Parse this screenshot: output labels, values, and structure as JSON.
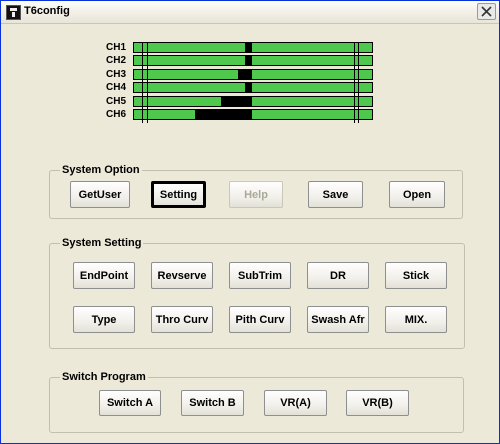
{
  "window": {
    "title": "T6config"
  },
  "channels": [
    {
      "label": "CH1",
      "value": 0.03
    },
    {
      "label": "CH2",
      "value": 0.03
    },
    {
      "label": "CH3",
      "value": 0.06
    },
    {
      "label": "CH4",
      "value": 0.03
    },
    {
      "label": "CH5",
      "value": 0.13
    },
    {
      "label": "CH6",
      "value": 0.24
    }
  ],
  "system_option": {
    "title": "System Option",
    "buttons": [
      "GetUser",
      "Setting",
      "Help",
      "Save",
      "Open"
    ]
  },
  "system_setting": {
    "title": "System Setting",
    "row1": [
      "EndPoint",
      "Revserve",
      "SubTrim",
      "DR",
      "Stick"
    ],
    "row2": [
      "Type",
      "Thro Curv",
      "Pith Curv",
      "Swash Afr",
      "MIX."
    ]
  },
  "switch_program": {
    "title": "Switch Program",
    "buttons": [
      "Switch A",
      "Switch B",
      "VR(A)",
      "VR(B)"
    ]
  },
  "colors": {
    "bar_green": "#4ec94e",
    "bar_fill": "#000000",
    "window_bg": "#ece9d8"
  }
}
